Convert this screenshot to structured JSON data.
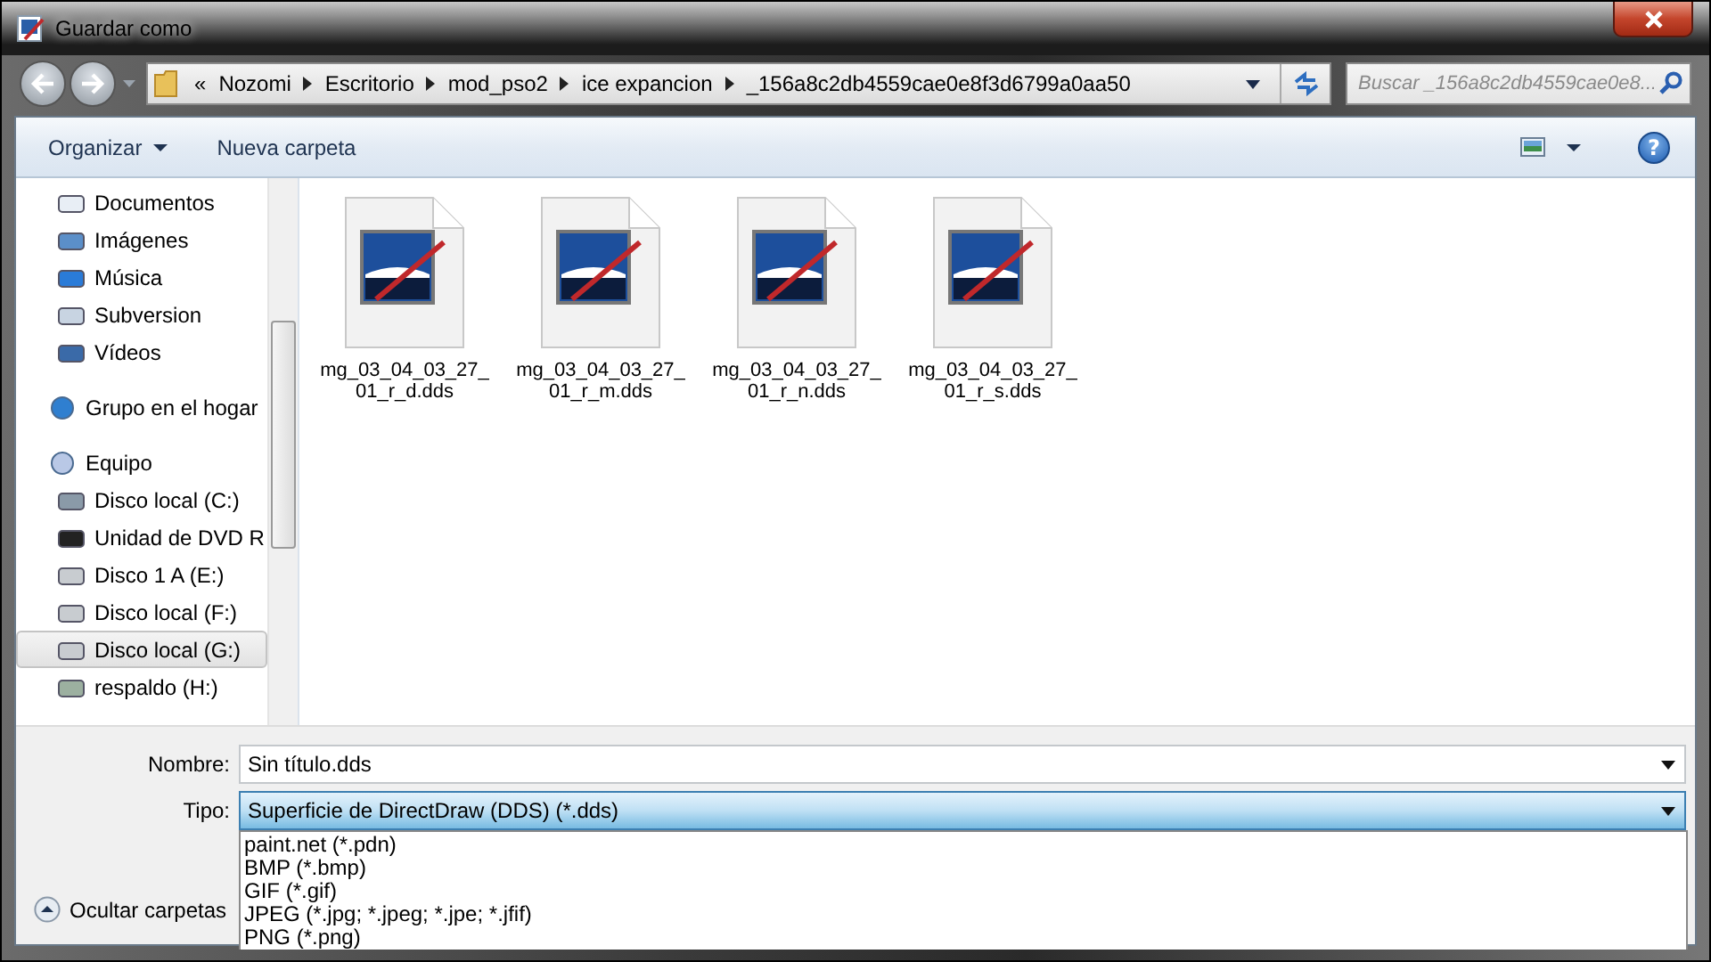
{
  "window": {
    "title": "Guardar como"
  },
  "address": {
    "overflow": "«",
    "segments": [
      "Nozomi",
      "Escritorio",
      "mod_pso2",
      "ice expancion",
      "_156a8c2db4559cae0e8f3d6799a0aa50"
    ]
  },
  "search": {
    "placeholder": "Buscar _156a8c2db4559cae0e8..."
  },
  "toolbar": {
    "organize": "Organizar",
    "new_folder": "Nueva carpeta",
    "help": "?"
  },
  "sidebar": {
    "tree": [
      {
        "children": [
          {
            "label": "Documentos",
            "kind": "document",
            "selected": false
          },
          {
            "label": "Imágenes",
            "kind": "image",
            "selected": false
          },
          {
            "label": "Música",
            "kind": "music",
            "selected": false
          },
          {
            "label": "Subversion",
            "kind": "svn",
            "selected": false
          },
          {
            "label": "Vídeos",
            "kind": "video",
            "selected": false
          }
        ]
      },
      {
        "label": "Grupo en el hogar",
        "kind": "homegroup",
        "selected": false
      },
      {
        "label": "Equipo",
        "kind": "computer",
        "selected": false,
        "children": [
          {
            "label": "Disco local (C:)",
            "kind": "system-drive",
            "selected": false
          },
          {
            "label": "Unidad de DVD R",
            "kind": "dvd",
            "selected": false
          },
          {
            "label": "Disco 1 A (E:)",
            "kind": "drive",
            "selected": false
          },
          {
            "label": "Disco local (F:)",
            "kind": "drive",
            "selected": false
          },
          {
            "label": "Disco local (G:)",
            "kind": "drive",
            "selected": true
          },
          {
            "label": "respaldo (H:)",
            "kind": "network",
            "selected": false
          }
        ]
      }
    ]
  },
  "files": [
    {
      "name": "mg_03_04_03_27_\n01_r_d.dds"
    },
    {
      "name": "mg_03_04_03_27_\n01_r_m.dds"
    },
    {
      "name": "mg_03_04_03_27_\n01_r_n.dds"
    },
    {
      "name": "mg_03_04_03_27_\n01_r_s.dds"
    }
  ],
  "form": {
    "name_label": "Nombre:",
    "name_value": "Sin título.dds",
    "type_label": "Tipo:",
    "type_value": "Superficie de DirectDraw (DDS) (*.dds)",
    "type_expanded": true,
    "type_options": [
      "paint.net (*.pdn)",
      "BMP (*.bmp)",
      "GIF (*.gif)",
      "JPEG (*.jpg; *.jpeg; *.jpe; *.jfif)",
      "PNG (*.png)"
    ]
  },
  "hide_folders": "Ocultar carpetas"
}
